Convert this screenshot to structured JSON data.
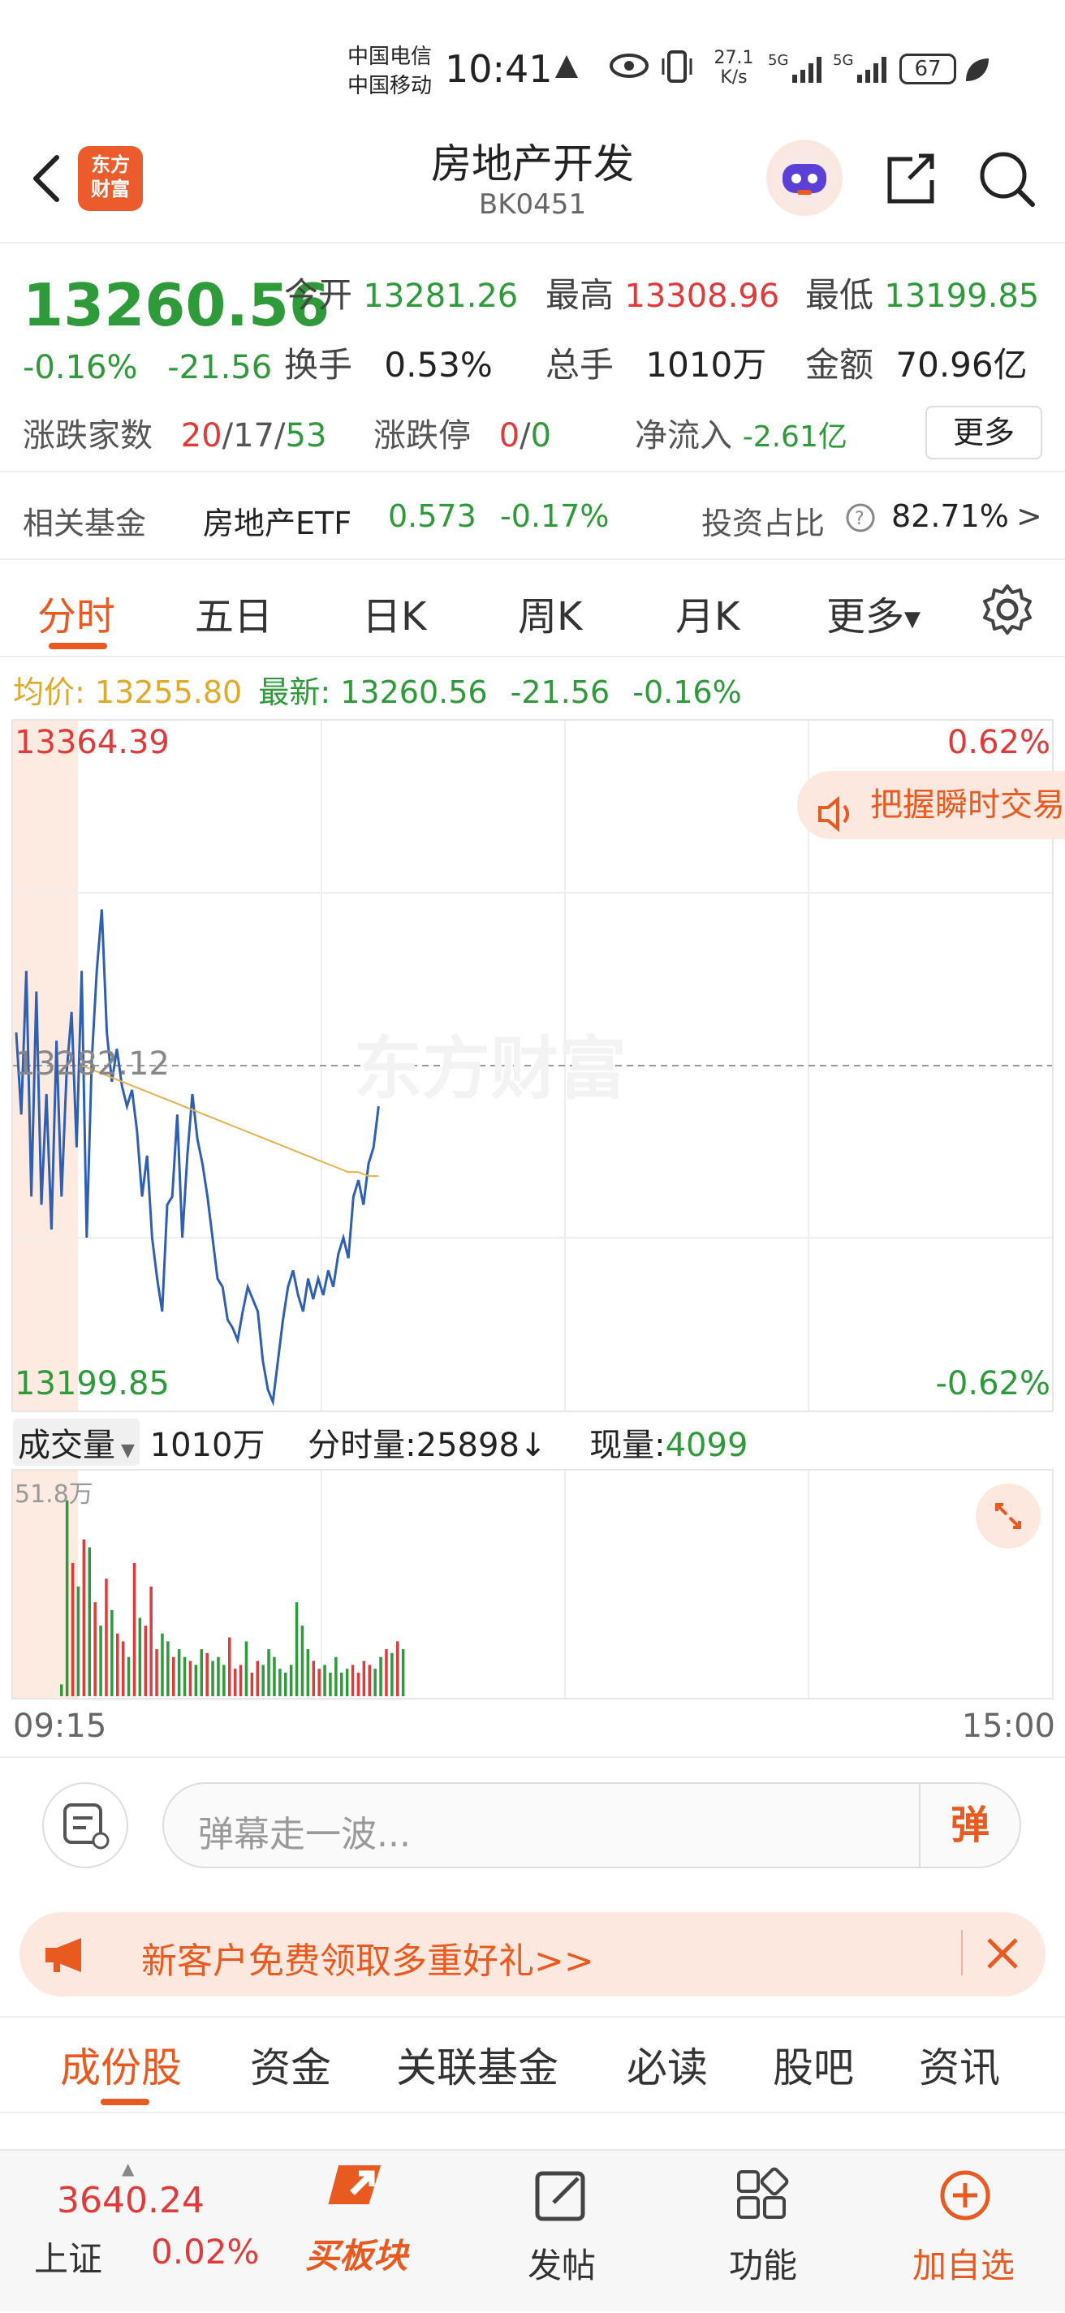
{
  "status_bar": {
    "carrier1": "中国电信",
    "carrier2": "中国移动",
    "time": "10:41",
    "speed": "27.1 K/s",
    "battery": "67"
  },
  "header": {
    "logo_text": "东方财富",
    "title": "房地产开发",
    "code": "BK0451"
  },
  "quote": {
    "price": "13260.56",
    "change_pct": "-0.16%",
    "change_abs": "-21.56",
    "open_label": "今开",
    "open": "13281.26",
    "high_label": "最高",
    "high": "13308.96",
    "low_label": "最低",
    "low": "13199.85",
    "turnover_label": "换手",
    "turnover": "0.53%",
    "volume_label": "总手",
    "volume": "1010万",
    "amount_label": "金额",
    "amount": "70.96亿",
    "updown_label": "涨跌家数",
    "up": "20",
    "flat": "17",
    "down": "53",
    "limit_label": "涨跌停",
    "limit_up": "0",
    "limit_down": "0",
    "netflow_label": "净流入",
    "netflow": "-2.61亿",
    "more_label": "更多"
  },
  "fund": {
    "label": "相关基金",
    "name": "房地产ETF",
    "price": "0.573",
    "change": "-0.17%",
    "ratio_label": "投资占比",
    "ratio": "82.71%"
  },
  "tabs": [
    "分时",
    "五日",
    "日K",
    "周K",
    "月K",
    "更多"
  ],
  "chart_header": {
    "avg_label": "均价:",
    "avg": "13255.80",
    "latest_label": "最新:",
    "latest": "13260.56",
    "chg": "-21.56",
    "pct": "-0.16%"
  },
  "chart": {
    "y_top": "13364.39",
    "y_bottom": "13199.85",
    "pct_top": "0.62%",
    "pct_bottom": "-0.62%",
    "ref_label": "13282.12",
    "watermark": "东方财富",
    "tip": "把握瞬时交易"
  },
  "volume": {
    "select_label": "成交量",
    "total": "1010万",
    "fen_label": "分时量:",
    "fen_value": "25898",
    "now_label": "现量:",
    "now_value": "4099",
    "max_label": "51.8万"
  },
  "time_axis": {
    "start": "09:15",
    "end": "15:00"
  },
  "comment": {
    "placeholder": "弹幕走一波...",
    "send": "弹"
  },
  "promo": {
    "text": "新客户免费领取多重好礼>>"
  },
  "bottom_tabs": [
    "成份股",
    "资金",
    "关联基金",
    "必读",
    "股吧",
    "资讯"
  ],
  "nav": {
    "index_value": "3640.24",
    "index_name": "上证",
    "index_pct": "0.02%",
    "buy_label": "买板块",
    "post_label": "发帖",
    "func_label": "功能",
    "add_label": "加自选"
  },
  "chart_data": {
    "type": "line",
    "ylim": [
      13199.85,
      13364.39
    ],
    "reference": 13282.12,
    "price": [
      13290,
      13270,
      13305,
      13250,
      13300,
      13248,
      13275,
      13242,
      13288,
      13250,
      13280,
      13295,
      13262,
      13305,
      13240,
      13283,
      13305,
      13320,
      13290,
      13278,
      13286,
      13277,
      13272,
      13276,
      13266,
      13250,
      13260,
      13240,
      13230,
      13222,
      13248,
      13250,
      13270,
      13240,
      13260,
      13275,
      13264,
      13258,
      13250,
      13240,
      13230,
      13228,
      13220,
      13218,
      13215,
      13222,
      13228,
      13225,
      13222,
      13210,
      13203,
      13200,
      13210,
      13220,
      13228,
      13232,
      13226,
      13222,
      13230,
      13225,
      13230,
      13226,
      13232,
      13228,
      13236,
      13240,
      13235,
      13250,
      13254,
      13248,
      13258,
      13262,
      13272
    ],
    "avg": [
      13282,
      13281,
      13280,
      13279,
      13278,
      13277,
      13276,
      13275,
      13274,
      13273,
      13272,
      13271,
      13270,
      13269,
      13268,
      13267,
      13266,
      13265,
      13264,
      13263,
      13262,
      13261,
      13260,
      13259,
      13258,
      13257,
      13256,
      13256,
      13255,
      13255
    ],
    "volume_max": 51.8,
    "volumes": [
      3,
      50,
      34,
      28,
      40,
      38,
      24,
      18,
      30,
      22,
      16,
      14,
      10,
      34,
      20,
      18,
      28,
      12,
      16,
      14,
      10,
      12,
      10,
      9,
      8,
      12,
      11,
      9,
      10,
      8,
      15,
      7,
      8,
      14,
      6,
      9,
      8,
      12,
      10,
      7,
      6,
      8,
      24,
      18,
      12,
      9,
      7,
      8,
      6,
      10,
      6,
      7,
      8,
      6,
      9,
      8,
      7,
      10,
      12,
      11,
      14,
      12
    ]
  }
}
